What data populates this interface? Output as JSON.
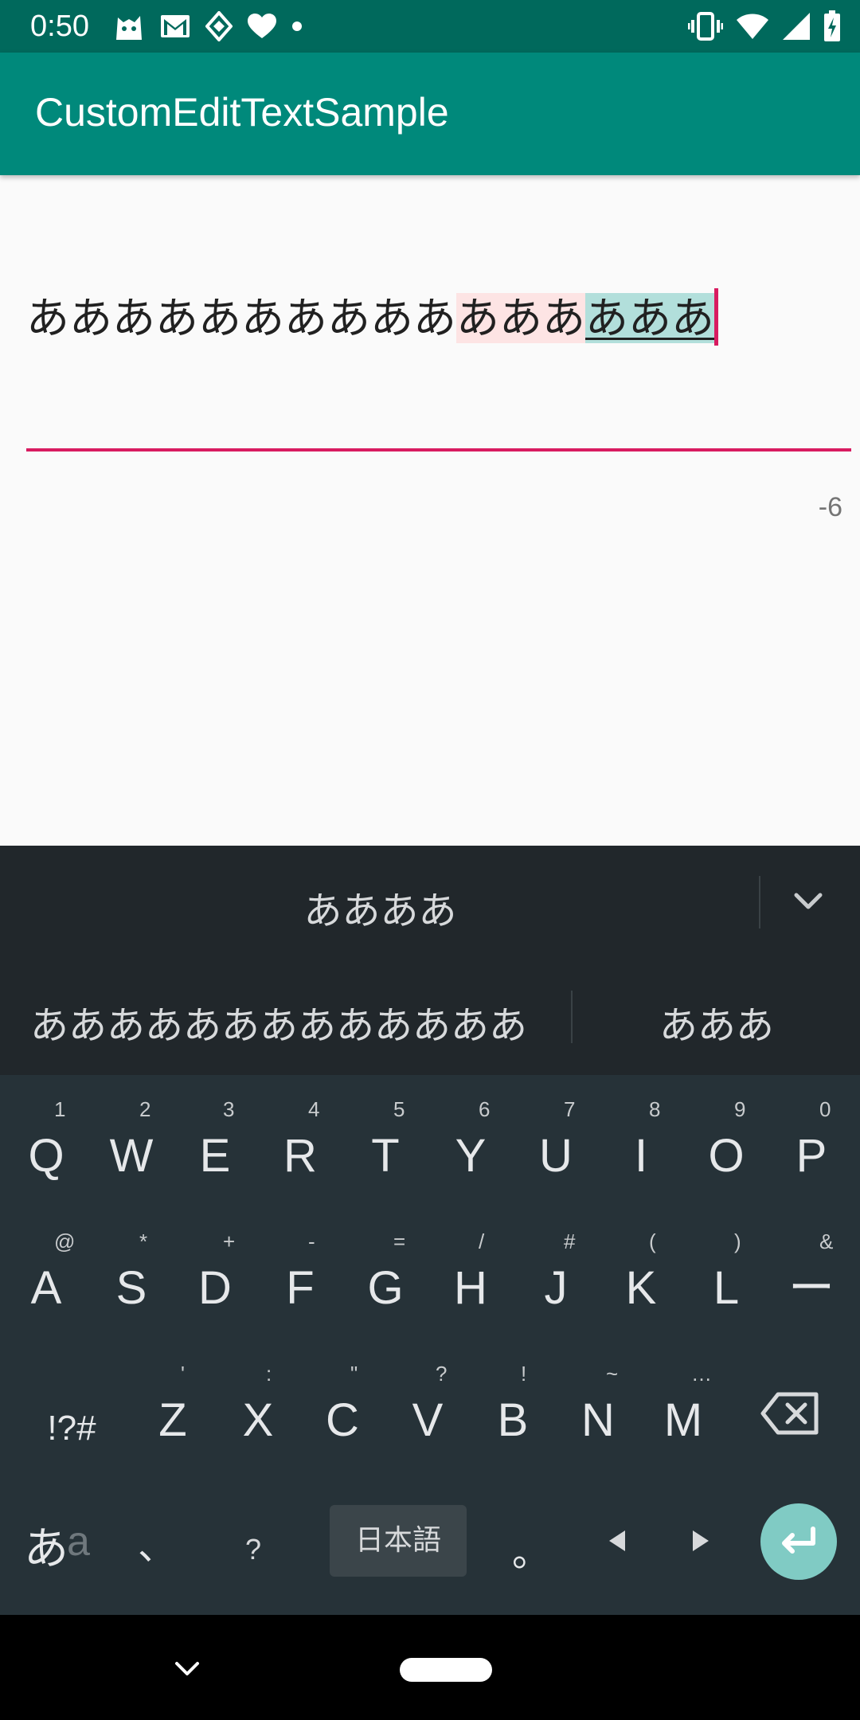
{
  "status_bar": {
    "time": "0:50",
    "left_icons": [
      "cat-notification-icon",
      "gmail-icon",
      "app-notification-icon",
      "heart-icon",
      "dot-icon"
    ],
    "right_icons": [
      "vibrate-icon",
      "wifi-icon",
      "cellular-signal-icon",
      "battery-icon"
    ]
  },
  "app_bar": {
    "title": "CustomEditTextSample"
  },
  "edit_text": {
    "segment_normal": "ああああああああああ",
    "segment_pink": "あああ",
    "segment_teal": "あああ",
    "underline_color": "#d81b60"
  },
  "counter": {
    "value": "-6"
  },
  "keyboard": {
    "top_candidate": "ああああ",
    "candidates": [
      "あああああああああああああ",
      "あああ"
    ],
    "rows": [
      {
        "keys": [
          {
            "label": "Q",
            "hint": "1"
          },
          {
            "label": "W",
            "hint": "2"
          },
          {
            "label": "E",
            "hint": "3"
          },
          {
            "label": "R",
            "hint": "4"
          },
          {
            "label": "T",
            "hint": "5"
          },
          {
            "label": "Y",
            "hint": "6"
          },
          {
            "label": "U",
            "hint": "7"
          },
          {
            "label": "I",
            "hint": "8"
          },
          {
            "label": "O",
            "hint": "9"
          },
          {
            "label": "P",
            "hint": "0"
          }
        ]
      },
      {
        "keys": [
          {
            "label": "A",
            "hint": "@"
          },
          {
            "label": "S",
            "hint": "*"
          },
          {
            "label": "D",
            "hint": "+"
          },
          {
            "label": "F",
            "hint": "-"
          },
          {
            "label": "G",
            "hint": "="
          },
          {
            "label": "H",
            "hint": "/"
          },
          {
            "label": "J",
            "hint": "#"
          },
          {
            "label": "K",
            "hint": "("
          },
          {
            "label": "L",
            "hint": ")"
          },
          {
            "label": "ー",
            "hint": "&"
          }
        ]
      },
      {
        "keys": [
          {
            "label": "Z",
            "hint": "'"
          },
          {
            "label": "X",
            "hint": ":"
          },
          {
            "label": "C",
            "hint": "\""
          },
          {
            "label": "V",
            "hint": "?"
          },
          {
            "label": "B",
            "hint": "!"
          },
          {
            "label": "N",
            "hint": "~"
          },
          {
            "label": "M",
            "hint": "…"
          }
        ]
      }
    ],
    "symbols_key": "!?#",
    "lang_key_main": "あ",
    "lang_key_sub": "a",
    "comma_key": "、",
    "question_key": "?",
    "space_label": "日本語",
    "period_key": "。",
    "colors": {
      "background": "#263238",
      "suggest_bg": "#21272b",
      "enter_bg": "#80cbc4"
    }
  },
  "colors": {
    "status_bar": "#00695c",
    "app_bar": "#00897b",
    "accent": "#d81b60"
  }
}
